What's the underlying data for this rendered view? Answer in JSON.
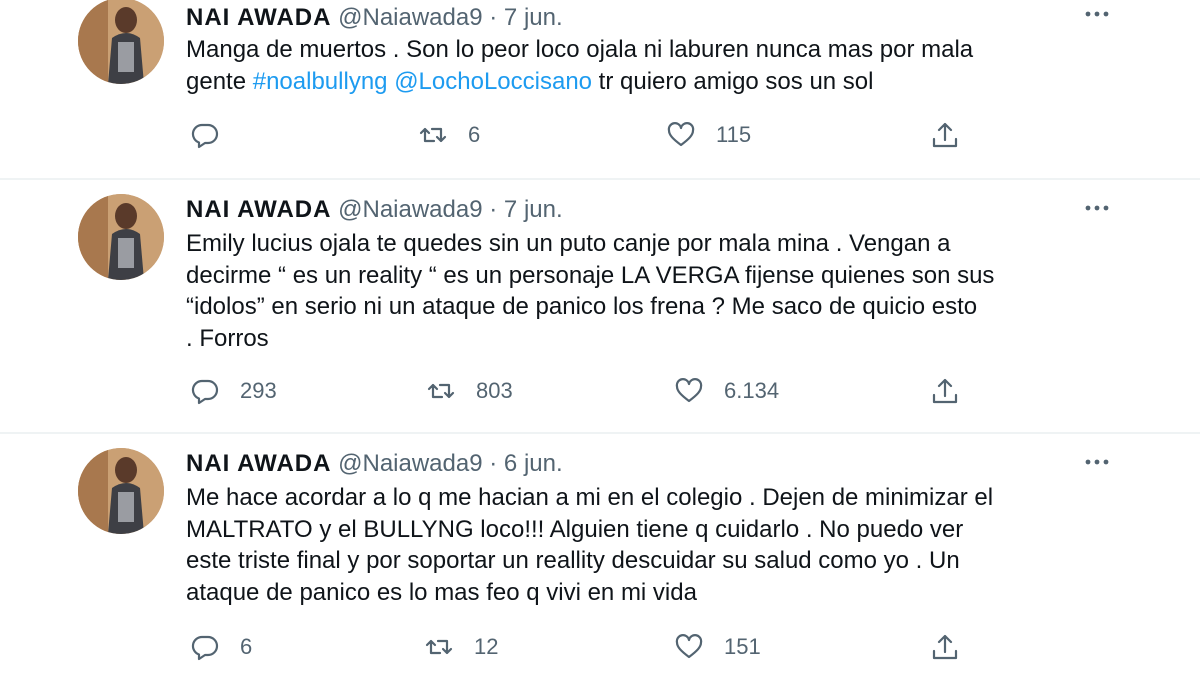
{
  "tweets": [
    {
      "name": "NAI AWADA",
      "handle": "@Naiawada9",
      "separator": "·",
      "date": "7 jun.",
      "body": [
        {
          "text": "Manga de muertos . Son lo peor loco ojala ni laburen nunca mas por mala"
        },
        {
          "text": "gente ",
          "hashtag": "#noalbullyng",
          "mention": "@LochoLoccisano",
          "after": " tr quiero amigo sos un sol"
        }
      ],
      "replies": "",
      "retweets": "6",
      "likes": "115"
    },
    {
      "name": "NAI AWADA",
      "handle": "@Naiawada9",
      "separator": "·",
      "date": "7 jun.",
      "body": [
        {
          "text": "Emily lucius ojala te quedes sin un puto canje por mala mina . Vengan a"
        },
        {
          "text": "decirme “ es un reality “ es un personaje LA VERGA fijense quienes son sus"
        },
        {
          "text": "“idolos” en serio ni un ataque de panico los frena ? Me saco de quicio esto"
        },
        {
          "text": ". Forros"
        }
      ],
      "replies": "293",
      "retweets": "803",
      "likes": "6.134"
    },
    {
      "name": "NAI AWADA",
      "handle": "@Naiawada9",
      "separator": "·",
      "date": "6 jun.",
      "body": [
        {
          "text": "Me hace acordar a lo q me hacian a mi en el colegio . Dejen de minimizar el"
        },
        {
          "text": "MALTRATO y el BULLYNG loco!!! Alguien tiene q cuidarlo . No puedo ver"
        },
        {
          "text": "este triste final y por soportar un reallity descuidar su salud como yo . Un"
        },
        {
          "text": "ataque de panico es lo mas feo q vivi en mi vida"
        }
      ],
      "replies": "6",
      "retweets": "12",
      "likes": "151"
    }
  ],
  "icons": {
    "reply": "reply-icon",
    "retweet": "retweet-icon",
    "like": "heart-icon",
    "share": "share-icon",
    "more": "more-icon"
  },
  "colors": {
    "text": "#0f1419",
    "secondary": "#536471",
    "link": "#1d9bf0",
    "divider": "#eff3f4"
  }
}
